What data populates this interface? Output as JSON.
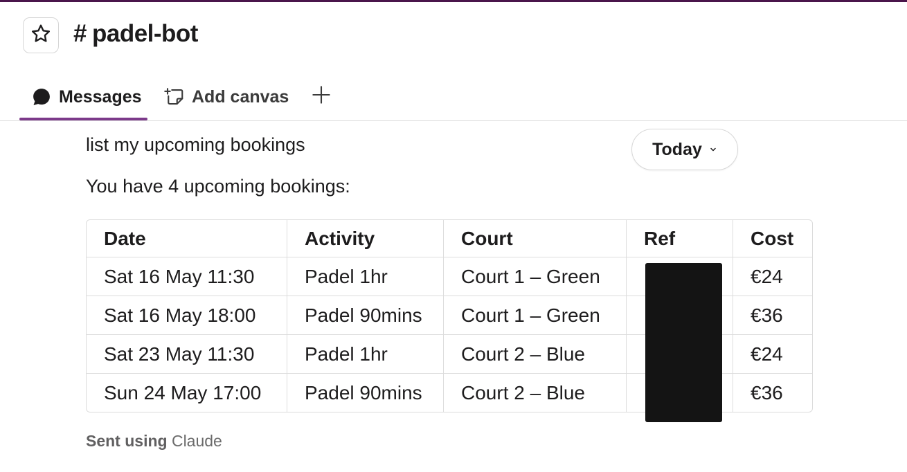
{
  "header": {
    "hash": "#",
    "channel_name": "padel-bot",
    "star_icon": "star-icon"
  },
  "tabs": [
    {
      "label": "Messages",
      "icon": "message-bubble-icon",
      "active": true
    },
    {
      "label": "Add canvas",
      "icon": "add-canvas-icon",
      "active": false
    },
    {
      "label": "",
      "icon": "plus-icon",
      "active": false
    }
  ],
  "colors": {
    "accent": "#7c3a8a",
    "top_rule": "#4a154b",
    "redaction": "#141414"
  },
  "messages": {
    "user_text": "list my upcoming bookings",
    "date_divider": "Today",
    "bot_text": "You have 4 upcoming bookings:",
    "table": {
      "headers": [
        "Date",
        "Activity",
        "Court",
        "Ref",
        "Cost"
      ],
      "rows": [
        [
          "Sat 16 May 11:30",
          "Padel 1hr",
          "Court 1 – Green",
          "",
          "€24"
        ],
        [
          "Sat 16 May 18:00",
          "Padel 90mins",
          "Court 1 – Green",
          "",
          "€36"
        ],
        [
          "Sat 23 May 11:30",
          "Padel 1hr",
          "Court 2 – Blue",
          "",
          "€24"
        ],
        [
          "Sun 24 May 17:00",
          "Padel 90mins",
          "Court 2 – Blue",
          "",
          "€36"
        ]
      ]
    },
    "footer_strong": "Sent using",
    "footer_app": "Claude"
  }
}
